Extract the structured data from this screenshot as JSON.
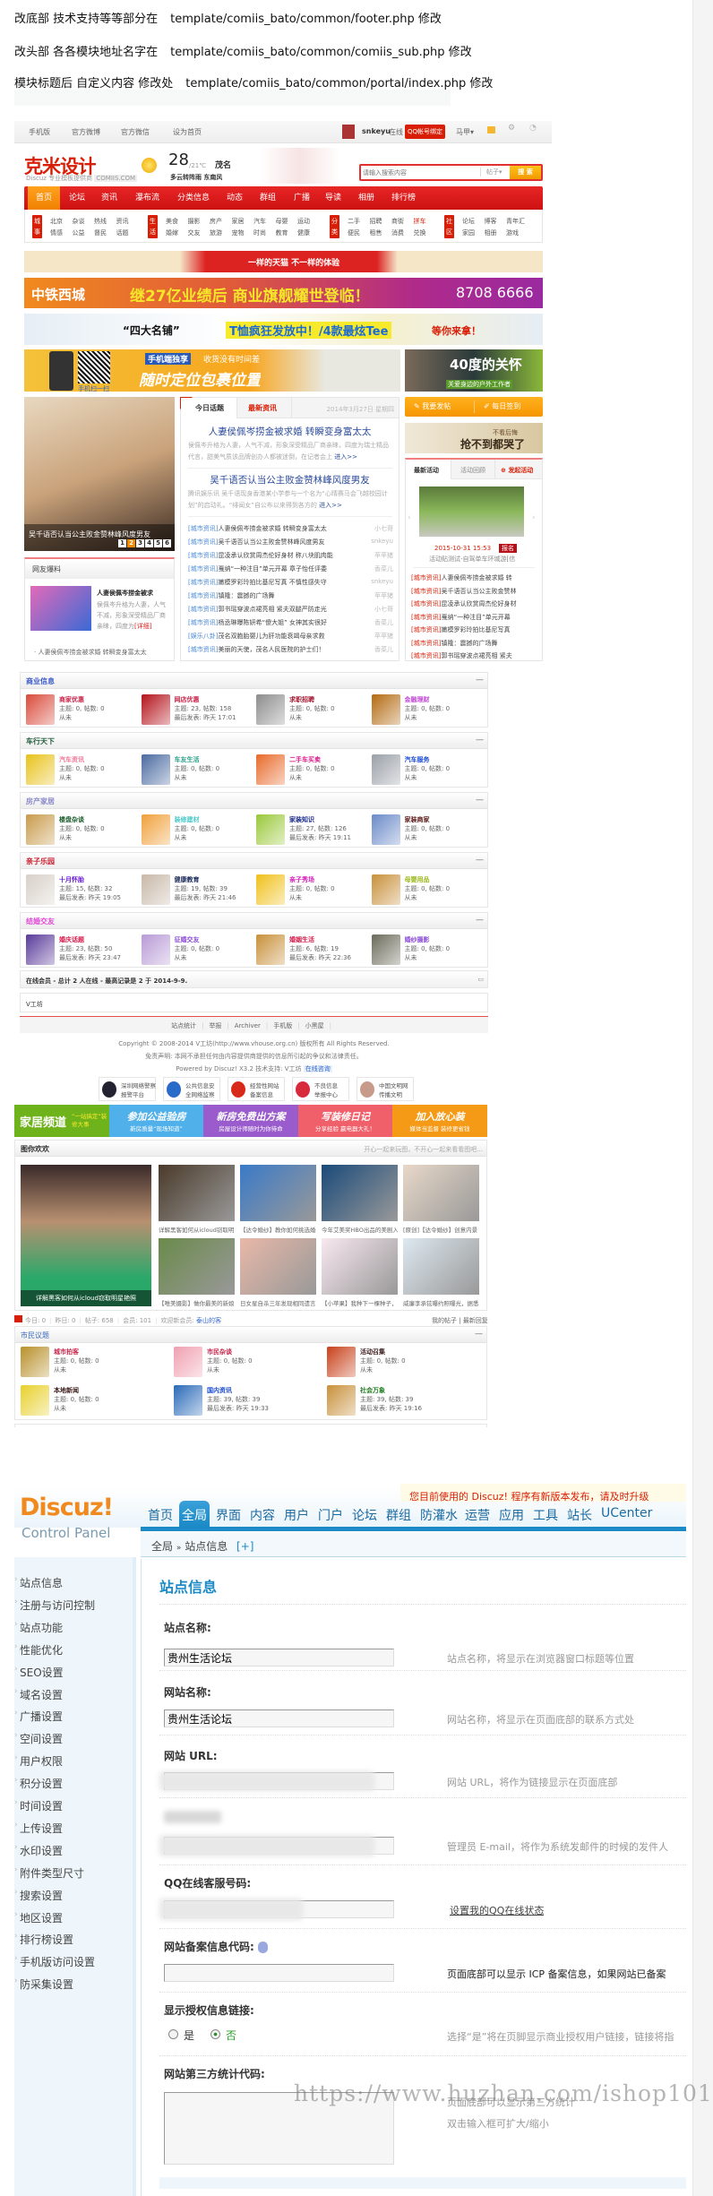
{
  "notes": [
    {
      "label": "改底部 技术支持等等部分在",
      "path": "template/comiis_bato/common/footer.php  修改"
    },
    {
      "label": "改头部 各各模块地址名字在",
      "path": "template/comiis_bato/common/comiis_sub.php 修改"
    },
    {
      "label": "模块标题后 自定义内容 修改处",
      "path": "template/comiis_bato/common/portal/index.php 修改"
    }
  ],
  "portal": {
    "topbar": {
      "links": [
        "手机版",
        "官方微博",
        "官方微信",
        "设为首页"
      ],
      "user": "snkeyu",
      "status": "在线",
      "qq_bind": "QQ帐号绑定",
      "vest": "马甲▾"
    },
    "logo": {
      "name": "克米设计",
      "sub": "Discuz 专业模板提供商",
      "domain": "COMIIS.COM"
    },
    "weather": {
      "temp": "28",
      "range": "/21℃",
      "city": "茂名",
      "desc": "多云转阵雨  东南风"
    },
    "search": {
      "placeholder": "请输入搜索内容",
      "type": "帖子▾",
      "button": "搜 索"
    },
    "nav": [
      "首页",
      "论坛",
      "资讯",
      "瀑布流",
      "分类信息",
      "动态",
      "群组",
      "广播",
      "导读",
      "相册",
      "排行榜"
    ],
    "subnav": [
      {
        "badge": "城事",
        "rows": [
          [
            "北京",
            "杂谈",
            "热线",
            "资讯"
          ],
          [
            "情感",
            "公益",
            "督民",
            "话题"
          ]
        ]
      },
      {
        "badge": "生活",
        "rows": [
          [
            "美食",
            "摄影",
            "房产",
            "家居",
            "汽车",
            "母婴",
            "运动"
          ],
          [
            "婚嫁",
            "交友",
            "旅游",
            "宠物",
            "时尚",
            "教育",
            "健康"
          ]
        ]
      },
      {
        "badge": "分类",
        "rows": [
          [
            "二手",
            "招聘",
            "商街",
            "拼车"
          ],
          [
            "便民",
            "租售",
            "消费",
            "兑换"
          ]
        ]
      },
      {
        "badge": "社区",
        "rows": [
          [
            "论坛",
            "博客",
            "青年汇"
          ],
          [
            "家园",
            "相册",
            "游戏"
          ]
        ]
      }
    ],
    "ads": {
      "tmall": "一样的天猫 不一样的体验",
      "zt_brand": "中铁西城",
      "zt_slogan": "继27亿业绩后  商业旗舰耀世登临！",
      "zt_phone": "8708 6666",
      "tee_a": "“四大名铺”",
      "tee_b": "T恤疯狂发放中！/4款最炫Tee",
      "tee_c": "等你来拿！",
      "mobile_tag": "手机端独享",
      "mobile_sub": "收货没有时间差",
      "mobile_main": "随时定位包裹位置",
      "mobile_scan": "手机扫一扫",
      "care_main": "40度的关怀",
      "care_sub": "关爱身边的户外工作者",
      "bag_small": "不看后悔",
      "bag_main": "抢不到都哭了"
    },
    "slider": {
      "caption": "吴千语否认当公主败金赞林峰风度男友",
      "pages": [
        "1",
        "2",
        "3",
        "4",
        "5",
        "6"
      ],
      "active": 1
    },
    "baoliao": {
      "title": "网友爆料",
      "item_title": "人妻侯佩岑捞金被求",
      "item_desc": "侯佩岑升格为人妻，人气不减，形象深受精品厂商亲睐，四度为",
      "more": "[详细]",
      "list": "· 人妻侯佩岑捞金被求婚 转瞬变身富太太"
    },
    "news": {
      "tabs": [
        "今日话题",
        "最新资讯"
      ],
      "date": "2014年3月27日 星期四",
      "headlines": [
        {
          "title": "人妻侯佩岑捞金被求婚 转瞬变身富太太",
          "desc": "侯佩岑升格为人妻，人气不减，形象深受精品厂商亲睐，四度为瑞士精品代言，甜美气质该品牌创办人都被迷倒，在记者会上",
          "more": "进入>>"
        },
        {
          "title": "吴千语否认当公主败金赞林峰风度男友",
          "desc": "腾讯娱乐讯 吴千语现身香港某小学参与一个名为“心晴赛马会飞越校园计划”的启动礼。“绯闻女”自公布以来得到各方的",
          "more": "进入>>"
        }
      ],
      "list": [
        {
          "tag": "[城市资讯]",
          "title": "人妻侯佩岑捞金被求婚 转瞬变身富太太",
          "author": "小七哥"
        },
        {
          "tag": "[城市资讯]",
          "title": "吴千语否认当公主败金赞林峰风度男友",
          "author": "snkeyu"
        },
        {
          "tag": "[城市资讯]",
          "title": "昆凌承认欣赏周杰伦好身材 称八块肌肉能",
          "author": "苹苹猪"
        },
        {
          "tag": "[城市资讯]",
          "title": "戛纳“一种注目”单元开幕 章子怡任评委",
          "author": "香菜儿"
        },
        {
          "tag": "[城市资讯]",
          "title": "嫩模罗彩玲拍比基尼写真 不慎性感失守",
          "author": "snkeyu"
        },
        {
          "tag": "[城市资讯]",
          "title": "镇隆：震撼的广场舞",
          "author": "苹苹猪"
        },
        {
          "tag": "[城市资讯]",
          "title": "郭书瑶穿波点裙亮相 紧夫双腿严防走光",
          "author": "小七哥"
        },
        {
          "tag": "[城市资讯]",
          "title": "杨丞琳曝陈妍希“傻大姐” 女神其实很好",
          "author": "香菜儿"
        },
        {
          "tag": "[娱乐八卦]",
          "title": "茂名双胞胎婴儿为肝功能衰竭母亲求救",
          "author": "苹苹猪"
        },
        {
          "tag": "[城市资讯]",
          "title": "美丽的天使，茂名人民医院的护士们！",
          "author": "香菜儿"
        }
      ]
    },
    "actions": {
      "post": "我要发帖",
      "sign": "每日签到"
    },
    "activity": {
      "tabs": [
        "最新活动",
        "活动回顾",
        "发起活动"
      ],
      "time": "2015-10-31 15:53",
      "signup": "报名",
      "title": "活动贴测试-自驾单车环城游[信",
      "list": [
        {
          "tag": "[城市资讯]",
          "title": "人妻侯佩岑捞金被求婚 转"
        },
        {
          "tag": "[城市资讯]",
          "title": "吴千语否认当公主败金赞林"
        },
        {
          "tag": "[城市资讯]",
          "title": "昆凌承认欣赏周杰伦好身材"
        },
        {
          "tag": "[城市资讯]",
          "title": "戛纳“一种注目”单元开幕"
        },
        {
          "tag": "[城市资讯]",
          "title": "嫩模罗彩玲拍比基尼写真"
        },
        {
          "tag": "[城市资讯]",
          "title": "镇隆：震撼的广场舞"
        },
        {
          "tag": "[城市资讯]",
          "title": "郭书瑶穿波点裙亮相 紧夫"
        }
      ]
    },
    "sections": [
      {
        "title": "商业信息",
        "color": "#3a5ac8",
        "items": [
          {
            "name": "商家优惠",
            "color": "#c8254a",
            "stats": "主题: 0, 帖数: 0",
            "last": "从未",
            "img": "#d94a3a"
          },
          {
            "name": "网店优惠",
            "color": "#c8254a",
            "stats": "主题: 23, 帖数: 158",
            "last": "最后发表: 昨天 17:01",
            "img": "#b3121a"
          },
          {
            "name": "求职招聘",
            "color": "#a0122a",
            "stats": "主题: 0, 帖数: 0",
            "last": "从未",
            "img": "#8c8c8c"
          },
          {
            "name": "金融理财",
            "color": "#c24ad6",
            "stats": "主题: 0, 帖数: 0",
            "last": "从未",
            "img": "#b36a10"
          }
        ]
      },
      {
        "title": "车行天下",
        "color": "#1f5a3a",
        "items": [
          {
            "name": "汽车资讯",
            "color": "#f07a9a",
            "stats": "主题: 0, 帖数: 0",
            "last": "从未",
            "img": "#e8c21a"
          },
          {
            "name": "车友生活",
            "color": "#2aa08a",
            "stats": "主题: 0, 帖数: 0",
            "last": "从未",
            "img": "#4a6aa0"
          },
          {
            "name": "二手车买卖",
            "color": "#d61a8a",
            "stats": "主题: 0, 帖数: 0",
            "last": "从未",
            "img": "#e86a2a"
          },
          {
            "name": "汽车服务",
            "color": "#1a4ad6",
            "stats": "主题: 0, 帖数: 0",
            "last": "从未",
            "img": "#9aa0a8"
          }
        ]
      },
      {
        "title": "房产家居",
        "color": "#8a8ac8",
        "items": [
          {
            "name": "楼盘杂谈",
            "color": "#1a5a2a",
            "stats": "主题: 0, 帖数: 0",
            "last": "从未",
            "img": "#c89a4a"
          },
          {
            "name": "装修建材",
            "color": "#4ac8c8",
            "stats": "主题: 0, 帖数: 0",
            "last": "从未",
            "img": "#f0a03a"
          },
          {
            "name": "家装知识",
            "color": "#1a2a8a",
            "stats": "主题: 27, 帖数: 126",
            "last": "最后发表: 昨天 19:11",
            "img": "#9ac83a"
          },
          {
            "name": "家装商家",
            "color": "#5a1a1a",
            "stats": "主题: 0, 帖数: 0",
            "last": "从未",
            "img": "#6a8ac8"
          }
        ]
      },
      {
        "title": "亲子乐园",
        "color": "#c81a2a",
        "items": [
          {
            "name": "十月怀胎",
            "color": "#6a1ad6",
            "stats": "主题: 15, 帖数: 32",
            "last": "最后发表: 昨天 19:05",
            "img": "#d8d0c8"
          },
          {
            "name": "健康教育",
            "color": "#1a2a5a",
            "stats": "主题: 19, 帖数: 39",
            "last": "最后发表: 昨天 21:46",
            "img": "#c8b8a8"
          },
          {
            "name": "亲子秀场",
            "color": "#d61ab8",
            "stats": "主题: 0, 帖数: 0",
            "last": "从未",
            "img": "#f0c01a"
          },
          {
            "name": "母婴用品",
            "color": "#9ab81a",
            "stats": "主题: 0, 帖数: 0",
            "last": "从未",
            "img": "#c8903a"
          }
        ]
      },
      {
        "title": "结婚交友",
        "color": "#e04ad6",
        "items": [
          {
            "name": "婚庆话题",
            "color": "#d61a4a",
            "stats": "主题: 23, 帖数: 50",
            "last": "最后发表: 昨天 23:47",
            "img": "#5a3a9a"
          },
          {
            "name": "征婚交友",
            "color": "#8a4ad6",
            "stats": "主题: 0, 帖数: 0",
            "last": "从未",
            "img": "#b89ad6"
          },
          {
            "name": "婚姻生活",
            "color": "#d61a4a",
            "stats": "主题: 6, 帖数: 19",
            "last": "最后发表: 昨天 22:36",
            "img": "#c8903a"
          },
          {
            "name": "婚纱摄影",
            "color": "#8a4ad6",
            "stats": "主题: 0, 帖数: 0",
            "last": "从未",
            "img": "#6a6a5a"
          }
        ]
      }
    ],
    "online": "在线会员 - 总计 2 人在线 - 最高记录是 2 于 2014-9-9.",
    "online_members": "V工坊",
    "footer": {
      "links": [
        "站点统计",
        "举报",
        "Archiver",
        "手机版",
        "小黑屋"
      ],
      "copyright": "Copyright © 2008-2014 V工坊(http://www.vhouse.org.cn) 版权所有 All Rights Reserved.",
      "disclaimer": "免责声明: 本网不承担任何由内容提供商提供的信息所引起的争议和法律责任。",
      "powered": "Powered by Discuz! X3.2  技术支持: V工坊",
      "consult": "在线咨询",
      "badges": [
        [
          "深圳网络警察",
          "报警平台"
        ],
        [
          "公共信息安",
          "全网络监察"
        ],
        [
          "经营性网站",
          "备案信息"
        ],
        [
          "不良信息",
          "举报中心"
        ],
        [
          "中国文明网",
          "传播文明"
        ]
      ]
    },
    "promo": [
      {
        "title": "家居频道",
        "sub": "“一站搞定”装修大事",
        "color": "#6fb31c"
      },
      {
        "title": "参加公益验房",
        "sub": "新房质量“现场知道”",
        "color": "#4fb0ea"
      },
      {
        "title": "新房免费出方案",
        "sub": "房屋设计师随时为你待命",
        "color": "#9a5ccc"
      },
      {
        "title": "写装修日记",
        "sub": "分享经验 赢电器大礼！",
        "color": "#f0606a"
      },
      {
        "title": "加入放心装",
        "sub": "媒体当监督 装修更省钱",
        "color": "#f59a16"
      }
    ],
    "pics": {
      "title": "图你欢欢",
      "slogan": "开心一起来玩图，不开心一起来看看图吧...",
      "big_caption": "详解黑客如何从icloud窃取明星艳照",
      "captions": [
        "详解黑客如何从icloud窃取明",
        "【达令婚纱】教你如何挑选婚",
        "今年艾美奖HBO出品的美剧入",
        "[原创]【达令婚纱】创意内景",
        "【唯美摄影】做你最美的新娘",
        "日女星自杀三年发现相同遗言",
        "【小苹果】我种下一棵种子，",
        "威廉李承铉曝约照曝光，据悉"
      ]
    },
    "stats": {
      "items": [
        "今日: 0",
        "昨日: 0",
        "帖子: 658",
        "会员: 101",
        "欢迎新会员:"
      ],
      "newest": "泰山的客",
      "my_posts": "我的帖子",
      "latest_replies": "最新回复"
    },
    "civic": {
      "title": "市民议题",
      "items": [
        {
          "name": "城市拍客",
          "color": "#c8254a",
          "stats": "主题: 0, 帖数: 0",
          "last": "从未",
          "img": "#b8902a"
        },
        {
          "name": "市民杂谈",
          "color": "#c8254a",
          "stats": "主题: 0, 帖数: 0",
          "last": "从未",
          "img": "#f0a0b0"
        },
        {
          "name": "活动召集",
          "color": "#3a1a1a",
          "stats": "主题: 0, 帖数: 0",
          "last": "从未",
          "img": "#c8401a"
        },
        {
          "name": "本地新闻",
          "color": "#3a1a1a",
          "stats": "主题: 0, 帖数: 0",
          "last": "从未",
          "img": "#e8d02a"
        },
        {
          "name": "国内资讯",
          "color": "#1a4ad6",
          "stats": "主题: 39, 帖数: 39",
          "last": "最后发表: 昨天 19:33",
          "img": "#2a6ab8"
        },
        {
          "name": "社会万象",
          "color": "#1a7a1a",
          "stats": "主题: 39, 帖数: 39",
          "last": "最后发表: 昨天 19:16",
          "img": "#c8903a"
        }
      ]
    }
  },
  "discuz": {
    "logo": "Discuz!",
    "logo_sub": "Control Panel",
    "notice": "您目前使用的 Discuz! 程序有新版本发布，请及时升级",
    "nav": [
      "首页",
      "全局",
      "界面",
      "内容",
      "用户",
      "门户",
      "论坛",
      "群组",
      "防灌水",
      "运营",
      "应用",
      "工具",
      "站长",
      "UCenter"
    ],
    "nav_active": 1,
    "breadcrumb": {
      "root": "全局",
      "sep": "»",
      "current": "站点信息",
      "add": "[+]"
    },
    "sidebar": [
      "站点信息",
      "注册与访问控制",
      "站点功能",
      "性能优化",
      "SEO设置",
      "域名设置",
      "广播设置",
      "空间设置",
      "用户权限",
      "积分设置",
      "时间设置",
      "上传设置",
      "水印设置",
      "附件类型尺寸",
      "搜索设置",
      "地区设置",
      "排行榜设置",
      "手机版访问设置",
      "防采集设置"
    ],
    "title": "站点信息",
    "fields": {
      "site_name": {
        "label": "站点名称:",
        "value": "贵州生活论坛",
        "help": "站点名称，将显示在浏览器窗口标题等位置"
      },
      "web_name": {
        "label": "网站名称:",
        "value": "贵州生活论坛",
        "help": "网站名称，将显示在页面底部的联系方式处"
      },
      "url": {
        "label": "网站 URL:",
        "help": "网站 URL，将作为链接显示在页面底部"
      },
      "email": {
        "help": "管理员 E-mail，将作为系统发邮件的时候的发件人"
      },
      "qq": {
        "label": "QQ在线客服号码:",
        "link": "设置我的QQ在线状态"
      },
      "icp": {
        "label": "网站备案信息代码:",
        "value": "",
        "help": "页面底部可以显示 ICP 备案信息，如果网站已备案"
      },
      "license": {
        "label": "显示授权信息链接:",
        "yes": "是",
        "no": "否",
        "selected": "no",
        "help": "选择“是”将在页脚显示商业授权用户链接，链接将指"
      },
      "stats": {
        "label": "网站第三方统计代码:",
        "help1": "页面底部可以显示第三方统计",
        "help2": "双击输入框可扩大/缩小"
      }
    }
  },
  "watermark": "https://www.huzhan.com/ishop1012"
}
